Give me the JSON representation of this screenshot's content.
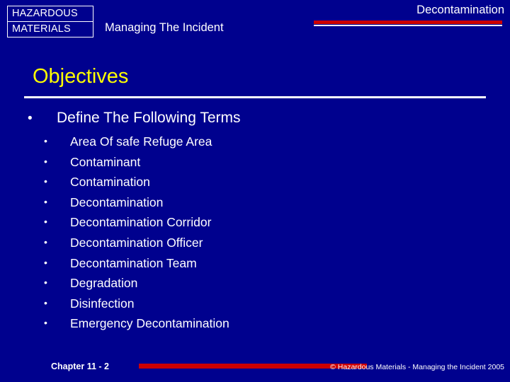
{
  "header": {
    "badge_line1": "HAZARDOUS",
    "badge_line2": "MATERIALS",
    "subtitle": "Managing The Incident",
    "right_title": "Decontamination"
  },
  "slide": {
    "title": "Objectives",
    "main_bullet": "Define The Following Terms",
    "bullet_glyph": "•",
    "sub_bullet_glyph": "•",
    "terms": [
      "Area Of safe Refuge Area",
      "Contaminant",
      "Contamination",
      "Decontamination",
      "Decontamination Corridor",
      "Decontamination Officer",
      "Decontamination Team",
      "Degradation",
      "Disinfection",
      "Emergency Decontamination"
    ]
  },
  "footer": {
    "chapter": "Chapter 11 - 2",
    "copyright": "© Hazardous Materials - Managing the Incident 2005"
  },
  "colors": {
    "background": "#00018E",
    "accent_red": "#CC0000",
    "title_yellow": "#FFFF00",
    "text_white": "#FFFFFF"
  }
}
